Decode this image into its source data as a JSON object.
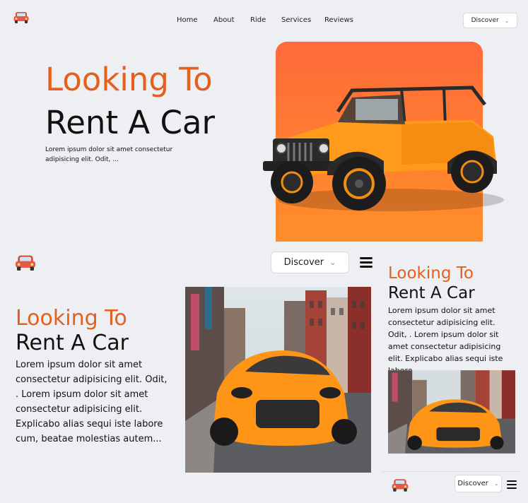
{
  "top": {
    "nav": [
      "Home",
      "About",
      "Ride",
      "Services",
      "Reviews"
    ],
    "discover_label": "Discover",
    "hero_line1": "Looking To",
    "hero_line2": "Rent A Car",
    "hero_text": "Lorem ipsum dolor sit amet consectetur adipisicing elit. Odit, ..."
  },
  "tablet": {
    "discover_label": "Discover",
    "hero_line1": "Looking To",
    "hero_line2": "Rent A Car",
    "hero_text": "Lorem ipsum dolor sit amet consectetur adipisicing elit. Odit, . Lorem ipsum dolor sit amet consectetur adipisicing elit. Explicabo alias sequi iste labore cum, beatae molestias autem..."
  },
  "mobile": {
    "hero_line1": "Looking To",
    "hero_line2": "Rent A Car",
    "hero_text": "Lorem ipsum dolor sit amet consectetur adipisicing elit. Odit, . Lorem ipsum dolor sit amet consectetur adipisicing elit. Explicabo alias sequi iste labore...",
    "discover_label": "Discover"
  },
  "icons": {
    "logo": "car-icon",
    "menu": "hamburger-menu-icon",
    "dropdown": "chevron-down-icon"
  },
  "colors": {
    "accent": "#e4601c",
    "background": "#eeeff2",
    "hero_panel": "#ff7a33"
  }
}
